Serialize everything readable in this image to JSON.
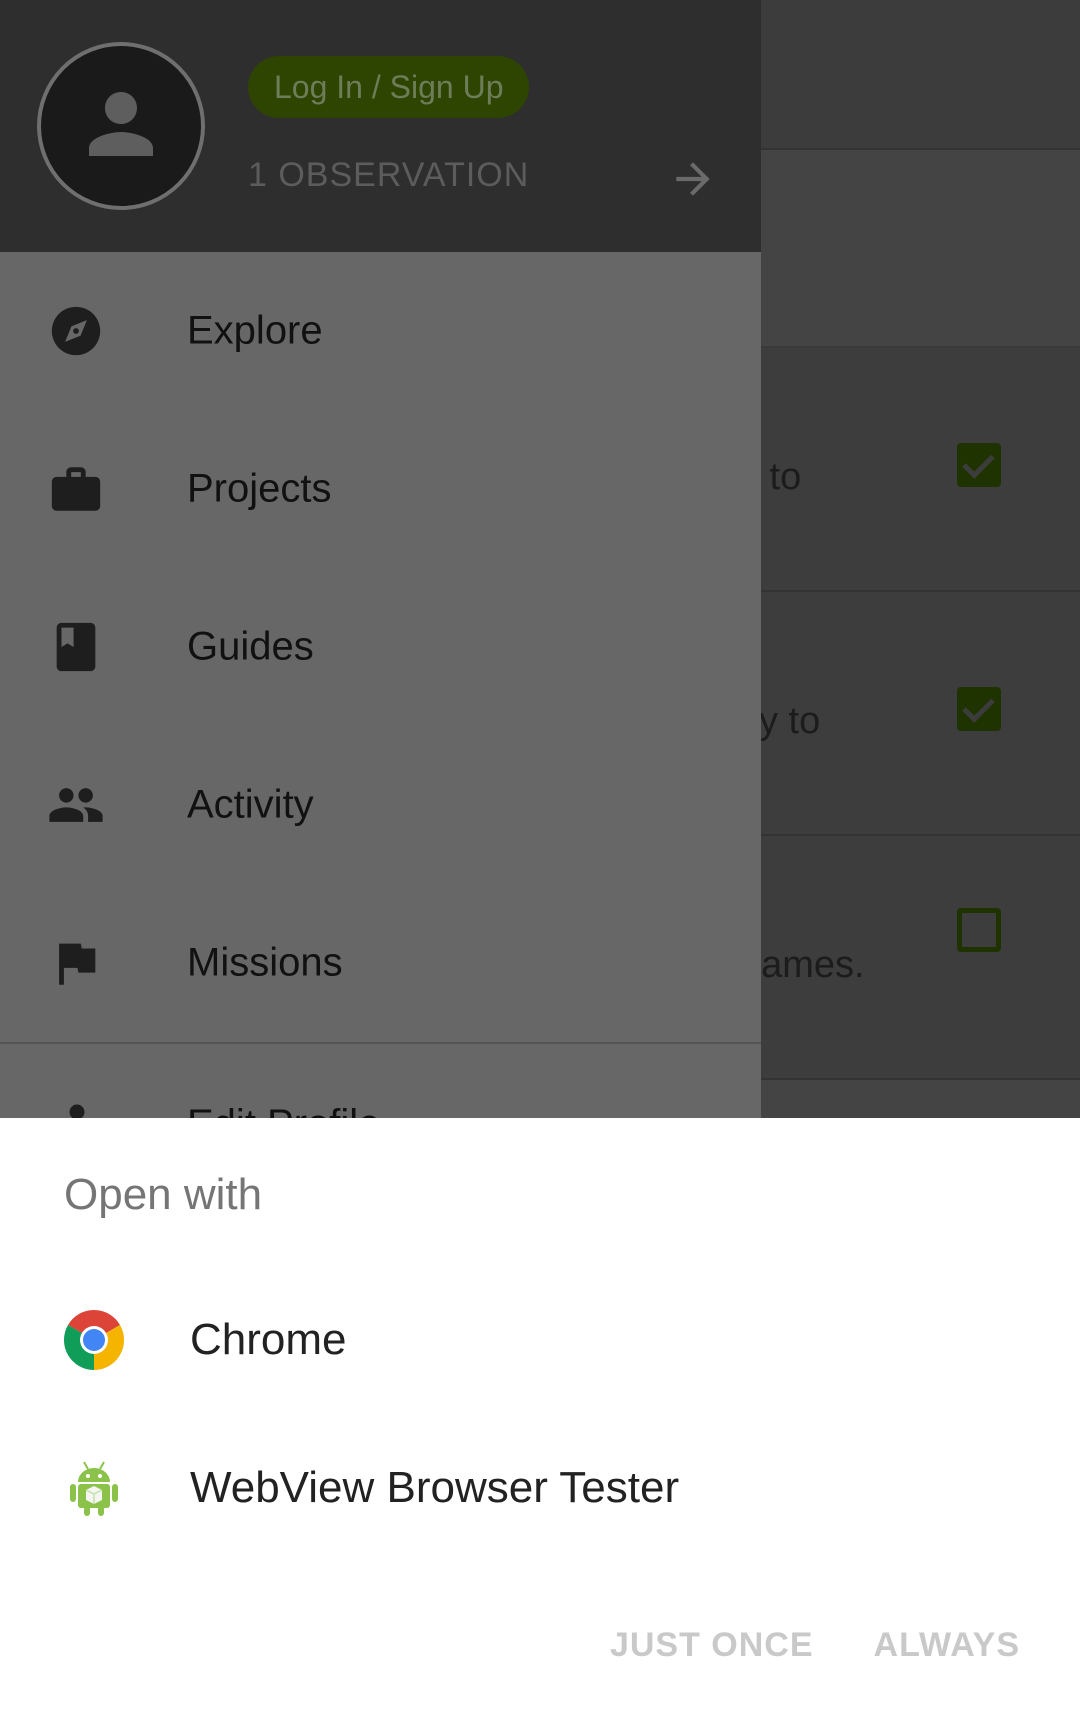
{
  "background": {
    "rows": [
      {
        "text": "s to",
        "checked": true
      },
      {
        "text": "ity to",
        "checked": true
      },
      {
        "text": "names.",
        "checked": false
      }
    ]
  },
  "drawer": {
    "login_label": "Log In / Sign Up",
    "observations": "1 OBSERVATION",
    "items": [
      {
        "label": "Explore",
        "icon": "compass-icon"
      },
      {
        "label": "Projects",
        "icon": "briefcase-icon"
      },
      {
        "label": "Guides",
        "icon": "book-icon"
      },
      {
        "label": "Activity",
        "icon": "people-icon"
      },
      {
        "label": "Missions",
        "icon": "flag-icon"
      }
    ],
    "edit_profile": "Edit Profile"
  },
  "sheet": {
    "title": "Open with",
    "apps": [
      {
        "name": "Chrome",
        "icon": "chrome-icon"
      },
      {
        "name": "WebView Browser Tester",
        "icon": "android-icon"
      }
    ],
    "just_once": "JUST ONCE",
    "always": "ALWAYS"
  },
  "colors": {
    "accent": "#74AC00",
    "scrim": "#000000"
  }
}
